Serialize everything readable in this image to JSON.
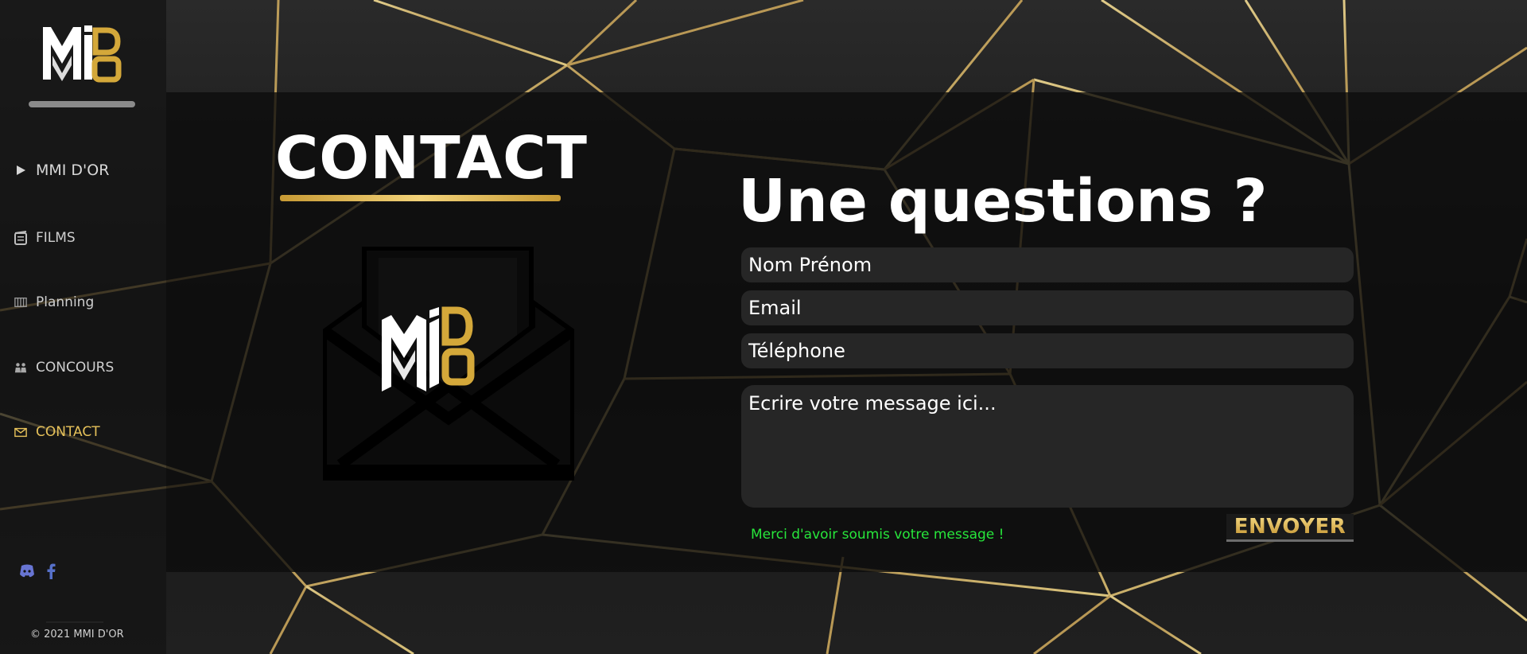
{
  "brand": {
    "logo_alt": "MMI D'OR",
    "logo_letters_top": "MI",
    "logo_letters_gold": "DOR",
    "accent_gold": "#e6c15a",
    "success_green": "#27e63b"
  },
  "sidebar": {
    "items": [
      {
        "label": "MMI D'OR",
        "icon": "play-icon"
      },
      {
        "label": "FILMS",
        "icon": "film-can-icon"
      },
      {
        "label": "Planning",
        "icon": "calendar-icon"
      },
      {
        "label": "CONCOURS",
        "icon": "trophy-people-icon"
      },
      {
        "label": "CONTACT",
        "icon": "envelope-icon",
        "active": true
      }
    ],
    "socials": [
      {
        "name": "discord",
        "icon": "discord-icon",
        "color": "#6875d3"
      },
      {
        "name": "facebook",
        "icon": "facebook-icon",
        "color": "#5670c9"
      }
    ],
    "copyright": "© 2021 MMI D'OR"
  },
  "page": {
    "title": "CONTACT"
  },
  "form": {
    "title": "Une questions ?",
    "name_placeholder": "Nom Prénom",
    "email_placeholder": "Email",
    "phone_placeholder": "Téléphone",
    "message_placeholder": "Ecrire votre message ici...",
    "success_message": "Merci d'avoir soumis votre message !",
    "submit_label": "ENVOYER"
  }
}
